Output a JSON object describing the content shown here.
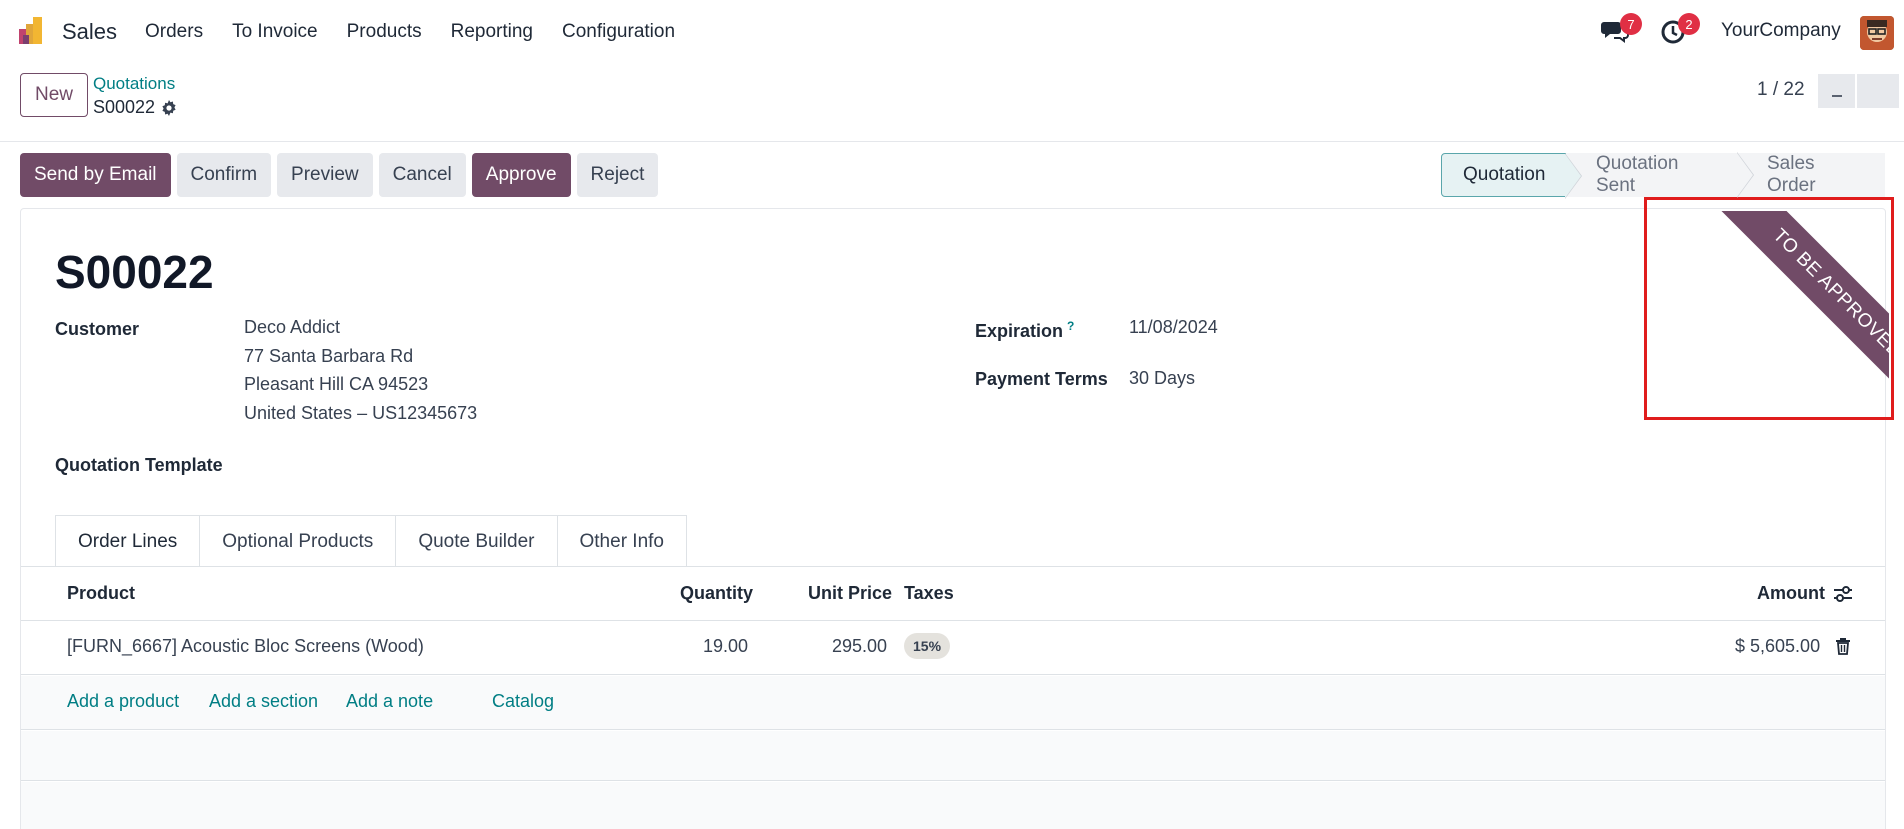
{
  "navbar": {
    "app_name": "Sales",
    "menu": [
      "Orders",
      "To Invoice",
      "Products",
      "Reporting",
      "Configuration"
    ],
    "messages_count": "7",
    "activities_count": "2",
    "company": "YourCompany"
  },
  "control_panel": {
    "new_label": "New",
    "breadcrumb_parent": "Quotations",
    "breadcrumb_current": "S00022",
    "pager_value": "1 / 22"
  },
  "actions": {
    "send_by_email": "Send by Email",
    "confirm": "Confirm",
    "preview": "Preview",
    "cancel": "Cancel",
    "approve": "Approve",
    "reject": "Reject"
  },
  "statusbar": {
    "stages": [
      "Quotation",
      "Quotation Sent",
      "Sales Order"
    ],
    "active": "Quotation"
  },
  "ribbon": "TO BE APPROVED",
  "form": {
    "title": "S00022",
    "customer_label": "Customer",
    "customer_lines": [
      "Deco Addict",
      "77 Santa Barbara Rd",
      "Pleasant Hill CA 94523",
      "United States – US12345673"
    ],
    "expiration_label": "Expiration",
    "expiration_help": "?",
    "expiration_value": "11/08/2024",
    "payment_terms_label": "Payment Terms",
    "payment_terms_value": "30 Days",
    "quotation_template_label": "Quotation Template"
  },
  "tabs": [
    "Order Lines",
    "Optional Products",
    "Quote Builder",
    "Other Info"
  ],
  "order_lines": {
    "columns": {
      "product": "Product",
      "quantity": "Quantity",
      "unit_price": "Unit Price",
      "taxes": "Taxes",
      "amount": "Amount"
    },
    "rows": [
      {
        "product": "[FURN_6667] Acoustic Bloc Screens (Wood)",
        "quantity": "19.00",
        "unit_price": "295.00",
        "taxes": "15%",
        "amount": "$ 5,605.00"
      }
    ],
    "add_links": {
      "add_product": "Add a product",
      "add_section": "Add a section",
      "add_note": "Add a note",
      "catalog": "Catalog"
    }
  },
  "colors": {
    "brand": "#714b67",
    "link": "#017e84",
    "highlight_box": "#e01c1c"
  }
}
